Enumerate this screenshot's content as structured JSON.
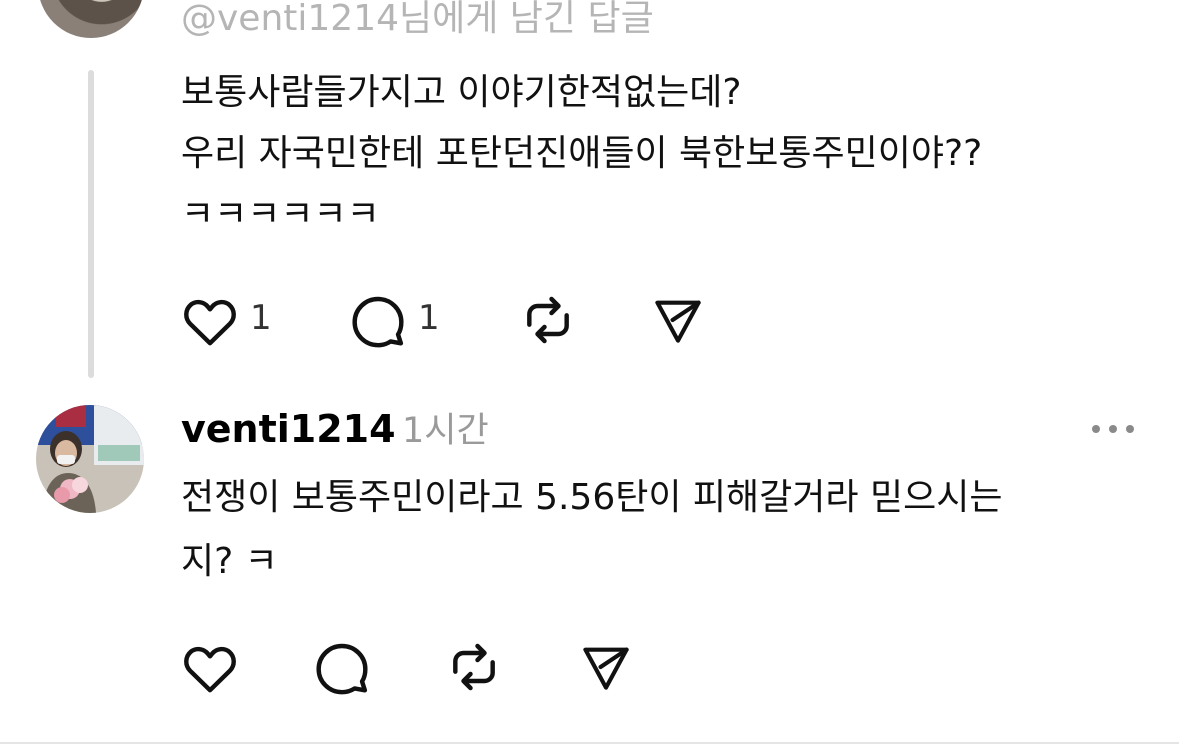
{
  "reply": {
    "reply_to_text": "@venti1214님에게 남긴 답글",
    "lines": [
      "보통사람들가지고 이야기한적없는데?",
      "우리 자국민한테 포탄던진애들이 북한보통주민이야??",
      "ㅋㅋㅋㅋㅋㅋ"
    ],
    "like_count": "1",
    "comment_count": "1"
  },
  "post": {
    "username": "venti1214",
    "time": "1시간",
    "lines": [
      "전쟁이 보통주민이라고 5.56탄이 피해갈거라 믿으시는",
      "지? ㅋ"
    ]
  },
  "icons": {
    "like": "heart-icon",
    "comment": "comment-bubble-icon",
    "repost": "repost-icon",
    "share": "send-icon",
    "more": "more-dots-icon"
  },
  "colors": {
    "secondary_text": "#9a9a9a",
    "thread_line": "#dcdcdc",
    "icon": "#111111"
  }
}
